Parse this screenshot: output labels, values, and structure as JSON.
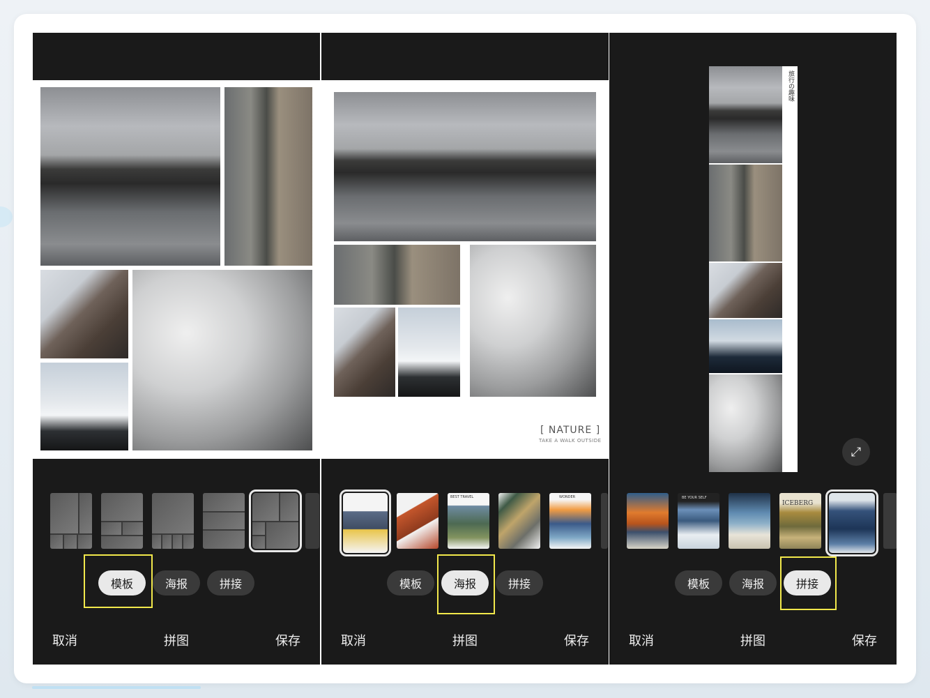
{
  "panels": [
    {
      "mode_tabs": [
        "模板",
        "海报",
        "拼接"
      ],
      "active_tab_index": 0,
      "bottom_bar": {
        "cancel": "取消",
        "title": "拼图",
        "save": "保存"
      }
    },
    {
      "mode_tabs": [
        "模板",
        "海报",
        "拼接"
      ],
      "active_tab_index": 1,
      "poster_text": {
        "title": "[ NATURE ]",
        "subtitle": "TAKE A WALK OUTSIDE"
      },
      "bottom_bar": {
        "cancel": "取消",
        "title": "拼图",
        "save": "保存"
      }
    },
    {
      "mode_tabs": [
        "模板",
        "海报",
        "拼接"
      ],
      "active_tab_index": 2,
      "vertical_caption": "旅行の趣味",
      "bottom_bar": {
        "cancel": "取消",
        "title": "拼图",
        "save": "保存"
      }
    }
  ],
  "poster_thumb_labels": [
    "BEST TRAVEL",
    "WONDER"
  ],
  "stitch_thumb_labels": [
    "BE YOUR SELF",
    "ICEBERG"
  ],
  "icons": {
    "expand": "expand-icon"
  },
  "colors": {
    "highlight": "#f2e84b",
    "screen_bg": "#1a1a1a",
    "pill_active": "#e9e9e9"
  }
}
